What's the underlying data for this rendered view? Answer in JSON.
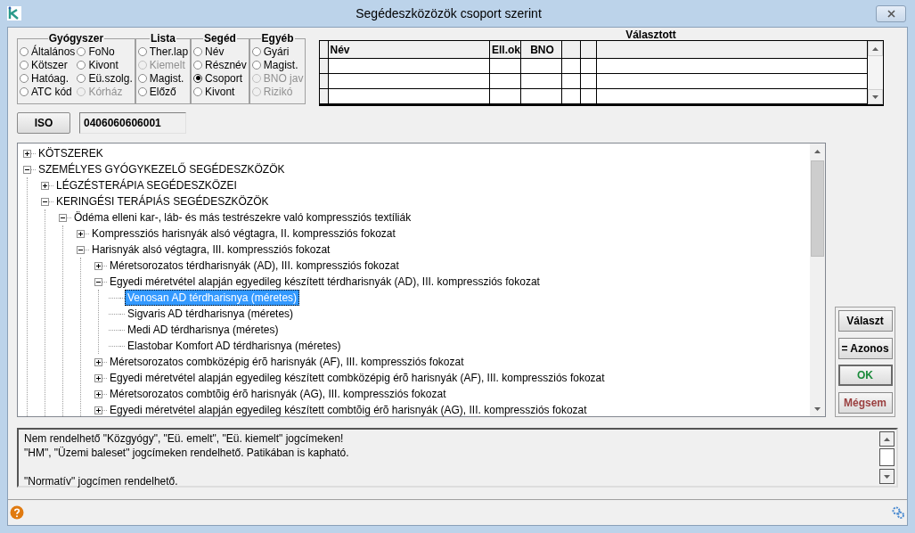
{
  "window": {
    "title": "Segédeszközözök csoport szerint"
  },
  "groups": [
    {
      "title": "Gyógyszer",
      "options": [
        {
          "label": "Általános",
          "selected": false,
          "disabled": false
        },
        {
          "label": "Kötszer",
          "selected": false,
          "disabled": false
        },
        {
          "label": "Hatóag.",
          "selected": false,
          "disabled": false
        },
        {
          "label": "ATC kód",
          "selected": false,
          "disabled": false
        },
        {
          "label": "FoNo",
          "selected": false,
          "disabled": false
        },
        {
          "label": "Kivont",
          "selected": false,
          "disabled": false
        },
        {
          "label": "Eü.szolg.",
          "selected": false,
          "disabled": false
        },
        {
          "label": "Kórház",
          "selected": false,
          "disabled": true
        }
      ]
    },
    {
      "title": "Lista",
      "options": [
        {
          "label": "Ther.lap",
          "selected": false,
          "disabled": false
        },
        {
          "label": "Kiemelt",
          "selected": false,
          "disabled": true
        },
        {
          "label": "Magist.",
          "selected": false,
          "disabled": false
        },
        {
          "label": "Előző",
          "selected": false,
          "disabled": false
        }
      ]
    },
    {
      "title": "Segéd",
      "options": [
        {
          "label": "Név",
          "selected": false,
          "disabled": false
        },
        {
          "label": "Résznév",
          "selected": false,
          "disabled": false
        },
        {
          "label": "Csoport",
          "selected": true,
          "disabled": false
        },
        {
          "label": "Kivont",
          "selected": false,
          "disabled": false
        }
      ]
    },
    {
      "title": "Egyéb",
      "options": [
        {
          "label": "Gyári",
          "selected": false,
          "disabled": false
        },
        {
          "label": "Magist.",
          "selected": false,
          "disabled": false
        },
        {
          "label": "BNO jav",
          "selected": false,
          "disabled": true
        },
        {
          "label": "Rizikó",
          "selected": false,
          "disabled": true
        }
      ]
    }
  ],
  "selected_table": {
    "title": "Választott",
    "columns": [
      "Név",
      "Ell.ok",
      "BNO"
    ]
  },
  "iso": {
    "button": "ISO",
    "value": "0406060606001"
  },
  "tree": [
    {
      "label": "KÖTSZEREK",
      "expanded": false,
      "selected": false
    },
    {
      "label": "SZEMÉLYES GYÓGYKEZELŐ SEGÉDESZKÖZÖK",
      "expanded": true,
      "selected": false,
      "children": [
        {
          "label": "LÉGZÉSTERÁPIA SEGÉDESZKÖZEI",
          "expanded": false,
          "selected": false
        },
        {
          "label": "KERINGÉSI TERÁPIÁS SEGÉDESZKÖZÖK",
          "expanded": true,
          "selected": false,
          "children": [
            {
              "label": "Ödéma elleni kar-, láb- és más testrészekre való kompressziós textíliák",
              "expanded": true,
              "selected": false,
              "children": [
                {
                  "label": "Kompressziós harisnyák alsó végtagra, II. kompressziós fokozat",
                  "expanded": false,
                  "selected": false
                },
                {
                  "label": "Harisnyák alsó végtagra, III. kompressziós fokozat",
                  "expanded": true,
                  "selected": false,
                  "children": [
                    {
                      "label": "Méretsorozatos térdharisnyák (AD), III. kompressziós fokozat",
                      "expanded": false,
                      "selected": false
                    },
                    {
                      "label": "Egyedi méretvétel alapján egyedileg készített térdharisnyák (AD), III. kompressziós fokozat",
                      "expanded": true,
                      "selected": false,
                      "children": [
                        {
                          "label": "Venosan AD térdharisnya (méretes)",
                          "selected": true
                        },
                        {
                          "label": "Sigvaris AD térdharisnya (méretes)",
                          "selected": false
                        },
                        {
                          "label": "Medi AD térdharisnya (méretes)",
                          "selected": false
                        },
                        {
                          "label": "Elastobar Komfort AD térdharisnya (méretes)",
                          "selected": false
                        }
                      ]
                    },
                    {
                      "label": "Méretsorozatos combközépig érõ harisnyák (AF), III. kompressziós fokozat",
                      "expanded": false,
                      "selected": false
                    },
                    {
                      "label": "Egyedi méretvétel alapján egyedileg készített combközépig érõ harisnyák (AF), III. kompressziós fokozat",
                      "expanded": false,
                      "selected": false
                    },
                    {
                      "label": "Méretsorozatos combtõig érõ harisnyák (AG), III. kompressziós fokozat",
                      "expanded": false,
                      "selected": false
                    },
                    {
                      "label": "Egyedi méretvétel alapján egyedileg készített combtõig érõ harisnyák (AG), III. kompressziós fokozat",
                      "expanded": false,
                      "selected": false
                    }
                  ]
                }
              ]
            }
          ]
        }
      ]
    }
  ],
  "buttons": [
    {
      "label": "Választ",
      "kind": "default"
    },
    {
      "label": "= Azonos",
      "kind": "default"
    },
    {
      "label": "OK",
      "kind": "ok"
    },
    {
      "label": "Mégsem",
      "kind": "cancel"
    }
  ],
  "notes": [
    {
      "lines": [
        "Nem rendelhető \"Közgyógy\", \"Eü. emelt\", \"Eü. kiemelt\" jogcímeken!",
        "\"HM\", \"Üzemi baleset\" jogcímeken rendelhető. Patikában is kapható."
      ]
    },
    {
      "lines": [
        "\"Normatív\" jogcímen rendelhető."
      ]
    }
  ]
}
